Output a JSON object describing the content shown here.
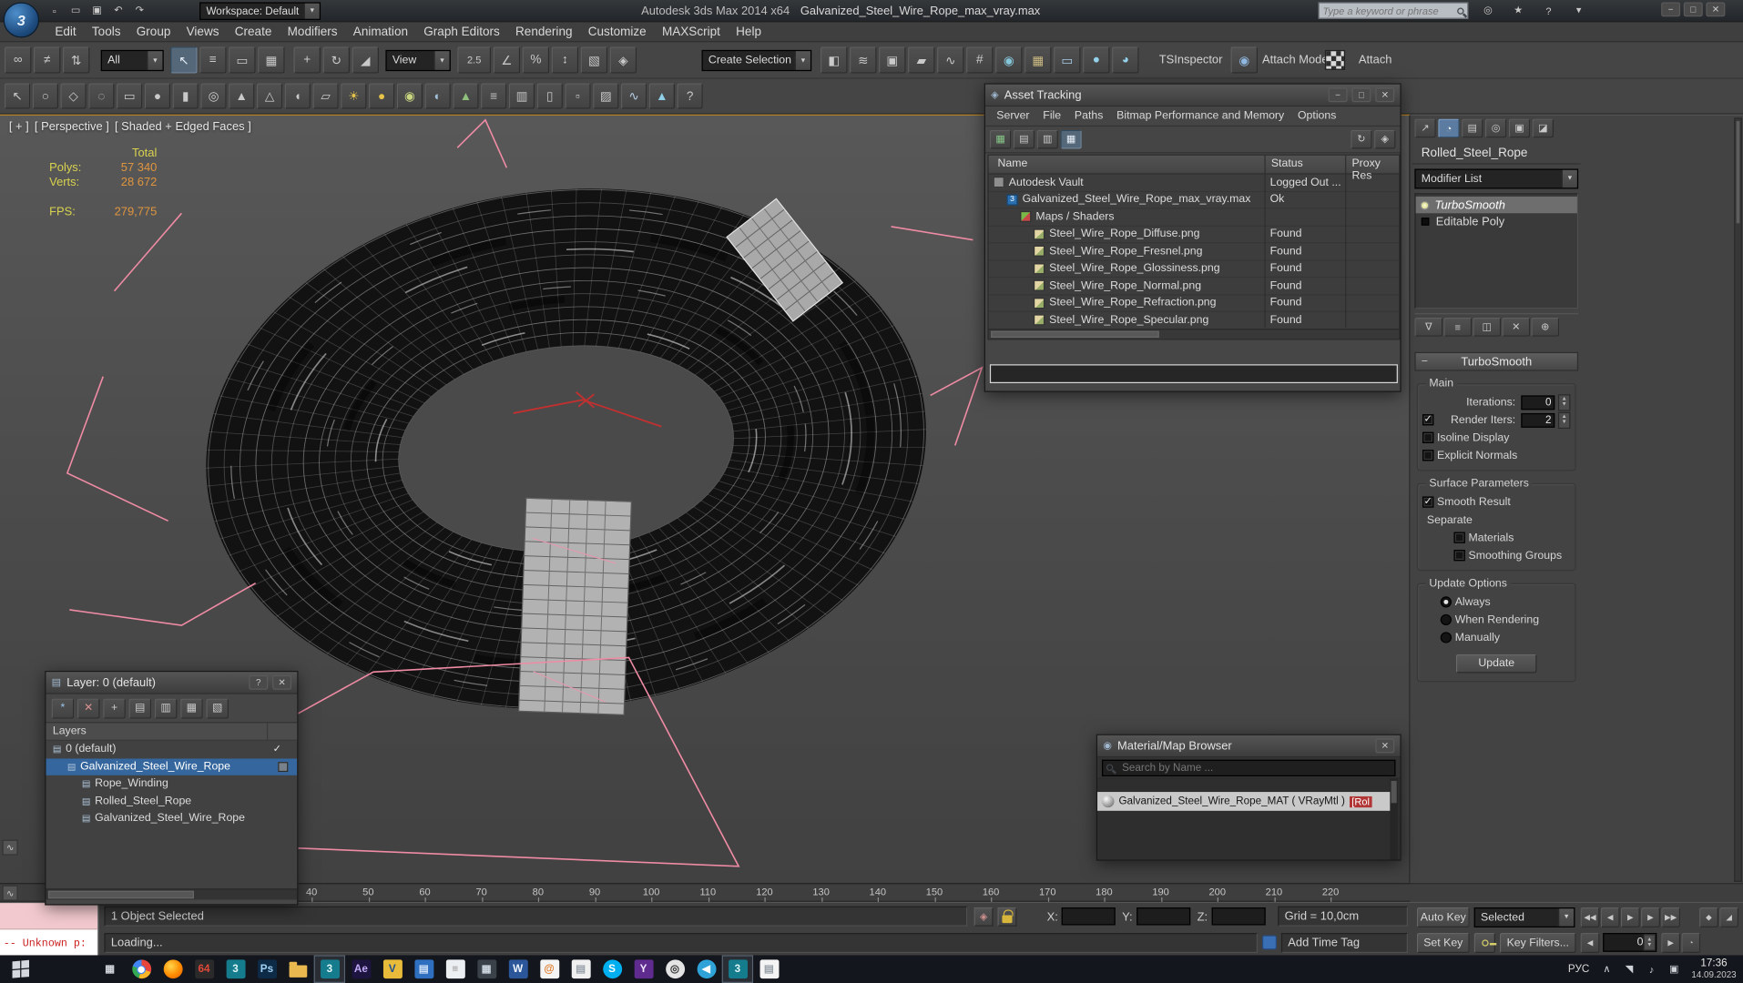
{
  "window": {
    "app_title": "Autodesk 3ds Max 2014 x64",
    "doc_title": "Galvanized_Steel_Wire_Rope_max_vray.max",
    "workspace": "Workspace: Default",
    "search_placeholder": "Type a keyword or phrase",
    "quick_icons": [
      {
        "name": "new-scene-icon",
        "glyph": "▫"
      },
      {
        "name": "open-file-icon",
        "glyph": "▭"
      },
      {
        "name": "save-file-icon",
        "glyph": "▣"
      },
      {
        "name": "undo-icon",
        "glyph": "↶"
      },
      {
        "name": "redo-icon",
        "glyph": "↷"
      }
    ],
    "controls": [
      {
        "name": "minimize-button",
        "glyph": "−",
        "cls": "ctl"
      },
      {
        "name": "maximize-button",
        "glyph": "□",
        "cls": "ctl"
      },
      {
        "name": "close-button",
        "glyph": "✕",
        "cls": "ctl"
      }
    ]
  },
  "infocenter": {
    "icons": [
      {
        "name": "communication-center-icon",
        "glyph": "◎"
      },
      {
        "name": "favorites-icon",
        "glyph": "★"
      },
      {
        "name": "help-icon",
        "glyph": "?"
      },
      {
        "name": "help-menu-arrow-icon",
        "glyph": "▾"
      }
    ]
  },
  "menubar": [
    "Edit",
    "Tools",
    "Group",
    "Views",
    "Create",
    "Modifiers",
    "Animation",
    "Graph Editors",
    "Rendering",
    "Customize",
    "MAXScript",
    "Help"
  ],
  "toolbar": {
    "selection_filter": "All",
    "coord_system": "View",
    "named_selection": "Create Selection Se",
    "tsinspector": "TSInspector",
    "attach_mode": "Attach Mode",
    "attach": "Attach",
    "g_link": [
      {
        "name": "select-and-link-icon",
        "glyph": "∞"
      },
      {
        "name": "unlink-selection-icon",
        "glyph": "≠"
      },
      {
        "name": "bind-to-spacewarp-icon",
        "glyph": "⇅"
      }
    ],
    "g_select": [
      {
        "name": "select-object-icon",
        "glyph": "↖",
        "cls": "pressed"
      },
      {
        "name": "select-by-name-icon",
        "glyph": "≡"
      },
      {
        "name": "rectangular-region-icon",
        "glyph": "▭"
      },
      {
        "name": "window-crossing-icon",
        "glyph": "▦"
      }
    ],
    "g_transform": [
      {
        "name": "select-and-move-icon",
        "glyph": "+"
      },
      {
        "name": "select-and-rotate-icon",
        "glyph": "↻"
      },
      {
        "name": "select-and-scale-icon",
        "glyph": "◢"
      }
    ],
    "g_snap": [
      {
        "name": "snaps-toggle-icon",
        "glyph": "2.5",
        "cls": "snap"
      },
      {
        "name": "angle-snap-icon",
        "glyph": "∠"
      },
      {
        "name": "percent-snap-icon",
        "glyph": "%"
      },
      {
        "name": "spinner-snap-icon",
        "glyph": "↕"
      },
      {
        "name": "edit-named-selection-icon",
        "glyph": "▧"
      },
      {
        "name": "isolate-selection-icon",
        "glyph": "◈"
      }
    ],
    "g_tools": [
      {
        "name": "mirror-icon",
        "glyph": "◧"
      },
      {
        "name": "align-icon",
        "glyph": "≋"
      },
      {
        "name": "layer-manager-icon",
        "glyph": "▣"
      },
      {
        "name": "ribbon-toggle-icon",
        "glyph": "▰"
      },
      {
        "name": "curve-editor-icon",
        "glyph": "∿"
      },
      {
        "name": "schematic-view-icon",
        "glyph": "#"
      },
      {
        "name": "material-editor-icon",
        "glyph": "◉",
        "fg": "#86c6da"
      },
      {
        "name": "render-setup-icon",
        "glyph": "▦",
        "fg": "#cdbb82"
      },
      {
        "name": "rendered-frame-icon",
        "glyph": "▭",
        "fg": "#a5cdea"
      },
      {
        "name": "render-production-icon",
        "glyph": "●",
        "fg": "#93d2ea"
      },
      {
        "name": "render-iterative-icon",
        "glyph": "◕",
        "fg": "#93d2ea"
      }
    ],
    "g_attach": [
      {
        "name": "attach-mode-icon",
        "glyph": "◉",
        "fg": "#8fb8e0"
      }
    ]
  },
  "toolbar2": {
    "icons": [
      {
        "name": "select-paint-icon",
        "glyph": "↖"
      },
      {
        "name": "circle-region-icon",
        "glyph": "○"
      },
      {
        "name": "fence-region-icon",
        "glyph": "◇"
      },
      {
        "name": "lasso-region-icon",
        "glyph": "◌"
      },
      {
        "name": "box-primitive-icon",
        "glyph": "▭"
      },
      {
        "name": "sphere-primitive-icon",
        "glyph": "●"
      },
      {
        "name": "cylinder-primitive-icon",
        "glyph": "▮"
      },
      {
        "name": "torus-primitive-icon",
        "glyph": "◎"
      },
      {
        "name": "cone-primitive-icon",
        "glyph": "▲"
      },
      {
        "name": "pyramid-primitive-icon",
        "glyph": "△"
      },
      {
        "name": "teapot-primitive-icon",
        "glyph": "◖"
      },
      {
        "name": "plane-primitive-icon",
        "glyph": "▱"
      },
      {
        "name": "sunlight-icon",
        "glyph": "☀",
        "fg": "#e6c44a"
      },
      {
        "name": "omni-light-icon",
        "glyph": "●",
        "fg": "#e6c44a"
      },
      {
        "name": "target-light-icon",
        "glyph": "◉",
        "fg": "#c9d67f"
      },
      {
        "name": "camera-icon",
        "glyph": "◐",
        "fg": "#9fc0d8"
      },
      {
        "name": "foliage-icon",
        "glyph": "▲",
        "fg": "#8fbf7a"
      },
      {
        "name": "railing-icon",
        "glyph": "≡"
      },
      {
        "name": "wall-icon",
        "glyph": "▥"
      },
      {
        "name": "door-icon",
        "glyph": "▯"
      },
      {
        "name": "window-icon",
        "glyph": "▫"
      },
      {
        "name": "stairs-icon",
        "glyph": "▨"
      },
      {
        "name": "bone-icon",
        "glyph": "∿",
        "fg": "#b8d0e8"
      },
      {
        "name": "biped-icon",
        "glyph": "▲",
        "fg": "#8fd0e8"
      },
      {
        "name": "help-icon",
        "glyph": "?"
      }
    ]
  },
  "viewport": {
    "menus": [
      "[ + ]",
      "[ Perspective ]",
      "[ Shaded + Edged Faces ]"
    ],
    "stats": {
      "total_label": "Total",
      "polys_label": "Polys:",
      "polys_value": "57 340",
      "verts_label": "Verts:",
      "verts_value": "28 672",
      "fps_label": "FPS:",
      "fps_value": "279,775"
    }
  },
  "asset_tracking": {
    "title": "Asset Tracking",
    "menus": [
      "Server",
      "File",
      "Paths",
      "Bitmap Performance and Memory",
      "Options"
    ],
    "toolbar_left": [
      {
        "name": "table-view-icon",
        "glyph": "▦",
        "fg": "#88c788"
      },
      {
        "name": "list-view-icon",
        "glyph": "▤"
      },
      {
        "name": "report-view-icon",
        "glyph": "▥"
      },
      {
        "name": "grid-view-icon",
        "glyph": "▦",
        "cls": "pressed"
      }
    ],
    "toolbar_right": [
      {
        "name": "refresh-icon",
        "glyph": "↻"
      },
      {
        "name": "highlight-icon",
        "glyph": "◈"
      }
    ],
    "controls": [
      {
        "name": "minimize-button",
        "glyph": "−",
        "cls": "ctl"
      },
      {
        "name": "maximize-button",
        "glyph": "□",
        "cls": "ctl"
      },
      {
        "name": "close-button",
        "glyph": "✕",
        "cls": "ctl"
      }
    ],
    "columns": [
      "Name",
      "Status",
      "Proxy Res"
    ],
    "rows": [
      {
        "name": "Autodesk Vault",
        "status": "Logged Out ...",
        "indent": 0,
        "icon": "vault"
      },
      {
        "name": "Galvanized_Steel_Wire_Rope_max_vray.max",
        "status": "Ok",
        "indent": 1,
        "icon": "max"
      },
      {
        "name": "Maps / Shaders",
        "status": "",
        "indent": 2,
        "icon": "maps"
      },
      {
        "name": "Steel_Wire_Rope_Diffuse.png",
        "status": "Found",
        "indent": 3,
        "icon": "png"
      },
      {
        "name": "Steel_Wire_Rope_Fresnel.png",
        "status": "Found",
        "indent": 3,
        "icon": "png"
      },
      {
        "name": "Steel_Wire_Rope_Glossiness.png",
        "status": "Found",
        "indent": 3,
        "icon": "png"
      },
      {
        "name": "Steel_Wire_Rope_Normal.png",
        "status": "Found",
        "indent": 3,
        "icon": "png"
      },
      {
        "name": "Steel_Wire_Rope_Refraction.png",
        "status": "Found",
        "indent": 3,
        "icon": "png"
      },
      {
        "name": "Steel_Wire_Rope_Specular.png",
        "status": "Found",
        "indent": 3,
        "icon": "png"
      }
    ]
  },
  "layer_dialog": {
    "title": "Layer: 0 (default)",
    "header": "Layers",
    "toolbar": [
      {
        "name": "create-new-layer-icon",
        "glyph": "*",
        "fg": "#9cc4ee"
      },
      {
        "name": "delete-layer-icon",
        "glyph": "✕",
        "fg": "#d89090"
      },
      {
        "name": "add-to-layer-icon",
        "glyph": "+"
      },
      {
        "name": "select-highlighted-icon",
        "glyph": "▤"
      },
      {
        "name": "set-current-layer-icon",
        "glyph": "▥"
      },
      {
        "name": "highlight-selected-layer-icon",
        "glyph": "▦"
      },
      {
        "name": "hide-freeze-toggle-icon",
        "glyph": "▧"
      }
    ],
    "controls": [
      {
        "name": "help-button",
        "glyph": "?",
        "cls": "ctl"
      },
      {
        "name": "close-button",
        "glyph": "✕",
        "cls": "ctl"
      }
    ],
    "rows": [
      {
        "label": "0 (default)",
        "indent": 0,
        "current": true
      },
      {
        "label": "Galvanized_Steel_Wire_Rope",
        "indent": 1,
        "selected": true
      },
      {
        "label": "Rope_Winding",
        "indent": 2
      },
      {
        "label": "Rolled_Steel_Rope",
        "indent": 2
      },
      {
        "label": "Galvanized_Steel_Wire_Rope",
        "indent": 2
      }
    ]
  },
  "material_browser": {
    "title": "Material/Map Browser",
    "search_placeholder": "Search by Name ...",
    "item_name": "Galvanized_Steel_Wire_Rope_MAT ( VRayMtl )",
    "item_badge": "[Rol",
    "controls": [
      {
        "name": "close-button",
        "glyph": "✕",
        "cls": "ctl"
      }
    ]
  },
  "command_panel": {
    "tabs": [
      {
        "name": "create-tab-icon",
        "glyph": "↗"
      },
      {
        "name": "modify-tab-icon",
        "glyph": "◔",
        "cls": "active"
      },
      {
        "name": "hierarchy-tab-icon",
        "glyph": "▤"
      },
      {
        "name": "motion-tab-icon",
        "glyph": "◎"
      },
      {
        "name": "display-tab-icon",
        "glyph": "▣"
      },
      {
        "name": "utilities-tab-icon",
        "glyph": "◪"
      }
    ],
    "object_name": "Rolled_Steel_Rope",
    "modifier_list_label": "Modifier List",
    "stack": [
      {
        "label": "TurboSmooth"
      },
      {
        "label": "Editable Poly"
      }
    ],
    "stack_tools": [
      {
        "name": "pin-stack-icon",
        "glyph": "∇"
      },
      {
        "name": "show-end-result-icon",
        "glyph": "≡"
      },
      {
        "name": "make-unique-icon",
        "glyph": "◫"
      },
      {
        "name": "remove-modifier-icon",
        "glyph": "✕"
      },
      {
        "name": "configure-modifier-sets-icon",
        "glyph": "⊕"
      }
    ],
    "rollout": {
      "title": "TurboSmooth",
      "main_label": "Main",
      "iterations_label": "Iterations:",
      "iterations_value": "0",
      "render_iters_label": "Render Iters:",
      "render_iters_value": "2",
      "render_iters_checked": true,
      "isoline_label": "Isoline Display",
      "isoline_checked": false,
      "explicit_label": "Explicit Normals",
      "explicit_checked": false,
      "surface_label": "Surface Parameters",
      "smooth_result_label": "Smooth Result",
      "smooth_result_checked": true,
      "separate_label": "Separate",
      "materials_label": "Materials",
      "materials_checked": false,
      "smoothing_label": "Smoothing Groups",
      "smoothing_checked": false,
      "update_label": "Update Options",
      "always_label": "Always",
      "always_selected": true,
      "when_label": "When Rendering",
      "when_selected": false,
      "manually_label": "Manually",
      "manually_selected": false,
      "update_button": "Update"
    }
  },
  "timeline": {
    "ticks": [
      "40",
      "50",
      "60",
      "70",
      "80",
      "90",
      "100",
      "110",
      "120",
      "130",
      "140",
      "150",
      "160",
      "170",
      "180",
      "190",
      "200",
      "210",
      "220"
    ]
  },
  "status_bar": {
    "selection_status": "1 Object Selected",
    "listener_text": "-- Unknown p:",
    "prompt": "Loading...",
    "x_label": "X:",
    "y_label": "Y:",
    "z_label": "Z:",
    "grid_label": "Grid = 10,0cm",
    "time_tag": "Add Time Tag"
  },
  "time_controls": {
    "auto_key": "Auto Key",
    "set_key": "Set Key",
    "selection_set": "Selected",
    "key_filters": "Key Filters...",
    "frame": "0",
    "playback": [
      {
        "name": "go-to-start-icon",
        "glyph": "◀◀"
      },
      {
        "name": "previous-frame-icon",
        "glyph": "◀"
      },
      {
        "name": "play-icon",
        "glyph": "▶",
        "cls": "wide"
      },
      {
        "name": "next-frame-icon",
        "glyph": "▶"
      },
      {
        "name": "go-to-end-icon",
        "glyph": "▶▶"
      }
    ],
    "extra1": [
      {
        "name": "key-mode-icon",
        "glyph": "◆"
      },
      {
        "name": "default-tangent-icon",
        "glyph": "◢"
      }
    ],
    "nav_prev": [
      {
        "name": "previous-key-icon",
        "glyph": "◀"
      }
    ],
    "nav_next": [
      {
        "name": "next-key-icon",
        "glyph": "▶"
      },
      {
        "name": "time-configuration-icon",
        "glyph": "◔"
      }
    ]
  },
  "taskbar": {
    "lang": "РУС",
    "time": "17:36",
    "date": "14.09.2023",
    "icons": [
      {
        "name": "app-tiles-icon",
        "glyph": "▦",
        "fg": "#d0d4da",
        "cls": "lbl"
      },
      {
        "name": "chrome-icon",
        "cls": "chrome"
      },
      {
        "name": "firefox-icon",
        "cls": "firefox"
      },
      {
        "name": "autodesk-64-icon",
        "glyph": "64",
        "fg": "#e04838",
        "bg": "#2a2a2a",
        "cls": "lbl"
      },
      {
        "name": "3dsmax-icon",
        "glyph": "3",
        "fg": "#dff3f6",
        "bg": "#147c8c",
        "cls": "lbl"
      },
      {
        "name": "photoshop-icon",
        "glyph": "Ps",
        "fg": "#9fd1f5",
        "bg": "#0d2b47",
        "cls": "lbl"
      },
      {
        "name": "explorer-folder-icon",
        "cls": "folder"
      },
      {
        "name": "3dsmax-running-icon",
        "glyph": "3",
        "fg": "#dff3f6",
        "bg": "#147c8c",
        "cls": "lbl",
        "active": true
      },
      {
        "name": "aftereffects-icon",
        "glyph": "Ae",
        "fg": "#c1aaf7",
        "bg": "#1d1440",
        "cls": "lbl"
      },
      {
        "name": "vray-icon",
        "glyph": "V",
        "fg": "#1d4e8f",
        "bg": "#e8bc3a",
        "cls": "lbl"
      },
      {
        "name": "app-window-icon",
        "glyph": "▤",
        "fg": "#cfe2f7",
        "bg": "#2f6fbf",
        "cls": "lbl"
      },
      {
        "name": "notepad-icon",
        "glyph": "≡",
        "fg": "#8a8a8a",
        "bg": "#eceff2",
        "cls": "lbl"
      },
      {
        "name": "settings-app-icon",
        "glyph": "▦",
        "fg": "#cdd5de",
        "bg": "#3a4149",
        "cls": "lbl"
      },
      {
        "name": "word-icon",
        "glyph": "W",
        "fg": "#eef4fb",
        "bg": "#2b579a",
        "cls": "lbl"
      },
      {
        "name": "mail-icon",
        "glyph": "@",
        "fg": "#e07b28",
        "bg": "#f4f4f4",
        "cls": "lbl"
      },
      {
        "name": "document-icon",
        "glyph": "▤",
        "fg": "#9aa2ab",
        "bg": "#f0f0f0",
        "cls": "lbl"
      },
      {
        "name": "skype-icon",
        "glyph": "S",
        "fg": "#ffffff",
        "bg": "#00aff0",
        "cls": "circle-lbl"
      },
      {
        "name": "yandex-icon",
        "glyph": "Y",
        "fg": "#f0e6ff",
        "bg": "#5f2b8f",
        "cls": "lbl"
      },
      {
        "name": "camera-app-icon",
        "glyph": "◎",
        "fg": "#3a3a3a",
        "bg": "#e4e4e4",
        "cls": "circle-lbl"
      },
      {
        "name": "telegram-icon",
        "glyph": "◀",
        "fg": "#ffffff",
        "bg": "#2fa3d8",
        "cls": "circle-lbl"
      },
      {
        "name": "3dsmax-doc-icon",
        "glyph": "3",
        "fg": "#dff3f6",
        "bg": "#147c8c",
        "cls": "lbl",
        "active": true
      },
      {
        "name": "notes-icon",
        "glyph": "▤",
        "fg": "#98a0a8",
        "bg": "#f4f4f4",
        "cls": "lbl"
      }
    ],
    "tray": [
      {
        "name": "hidden-icons-chevron-icon",
        "glyph": "∧"
      },
      {
        "name": "network-icon",
        "glyph": "◥"
      },
      {
        "name": "volume-icon",
        "glyph": "♪"
      },
      {
        "name": "action-center-icon",
        "glyph": "▣"
      }
    ]
  }
}
